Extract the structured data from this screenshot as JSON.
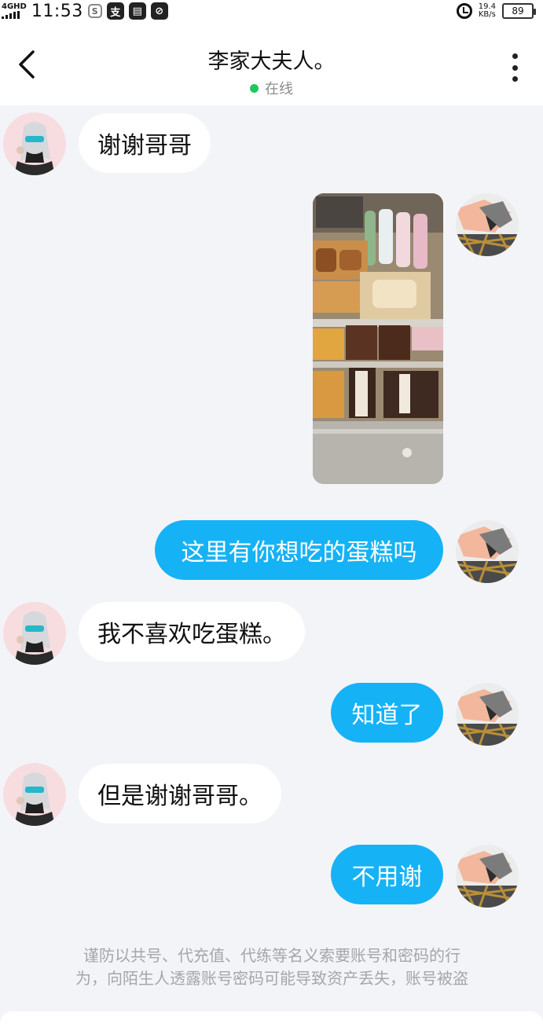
{
  "status_bar": {
    "network": "4GHD",
    "time": "11:53",
    "app_icon_label": "支",
    "speed_value": "19.4",
    "speed_unit": "KB/s",
    "battery": "89"
  },
  "header": {
    "back_icon": "chevron-left-icon",
    "title": "李家大夫人。",
    "status": "在线",
    "status_color": "#22c55e",
    "more_icon": "more-vertical-icon"
  },
  "messages": [
    {
      "sender": "contact",
      "type": "text",
      "text": "谢谢哥哥"
    },
    {
      "sender": "me",
      "type": "image",
      "description": "photo"
    },
    {
      "sender": "me",
      "type": "text",
      "text": "这里有你想吃的蛋糕吗"
    },
    {
      "sender": "contact",
      "type": "text",
      "text": "我不喜欢吃蛋糕。"
    },
    {
      "sender": "me",
      "type": "text",
      "text": "知道了"
    },
    {
      "sender": "contact",
      "type": "text",
      "text": "但是谢谢哥哥。"
    },
    {
      "sender": "me",
      "type": "text",
      "text": "不用谢"
    }
  ],
  "notice": {
    "line1": "谨防以共号、代充值、代练等名义索要账号和密码的行",
    "line2": "为，向陌生人透露账号密码可能导致资产丢失，账号被盗"
  },
  "colors": {
    "outgoing_bubble": "#16b2f6",
    "incoming_bubble": "#ffffff",
    "background": "#f3f4f7"
  }
}
